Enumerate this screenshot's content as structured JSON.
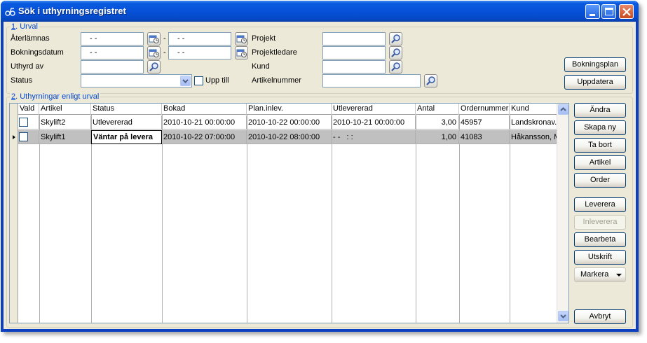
{
  "window": {
    "title": "Sök i uthyrningsregistret"
  },
  "filter_group": {
    "legend_num": "1",
    "legend_rest": ". Urval",
    "aterlamnas": {
      "label": "Återlämnas",
      "from": "- -",
      "sep": "-",
      "to": "- -"
    },
    "bokningsdatum": {
      "label": "Bokningsdatum",
      "from": "- -",
      "sep": "-",
      "to": "- -"
    },
    "uthyrd_av": {
      "label": "Uthyrd av",
      "value": ""
    },
    "status": {
      "label": "Status",
      "value": "",
      "upp_till_label": "Upp till"
    },
    "projekt": {
      "label": "Projekt",
      "value": ""
    },
    "projektledare": {
      "label": "Projektledare",
      "value": ""
    },
    "kund": {
      "label": "Kund",
      "value": ""
    },
    "artikelnummer": {
      "label": "Artikelnummer",
      "value": ""
    }
  },
  "top_buttons": {
    "bokningsplan": "Bokningsplan",
    "uppdatera": "Uppdatera"
  },
  "results_group": {
    "legend_num": "2",
    "legend_rest": ". Uthyrningar enligt urval",
    "columns": [
      "Vald",
      "Artikel",
      "Status",
      "Bokad",
      "Plan.inlev.",
      "Utlevererad",
      "Antal",
      "Ordernummer",
      "Kund"
    ],
    "rows": [
      {
        "vald": false,
        "artikel": "Skylift2",
        "status": "Utlevererad",
        "bokad": "2010-10-21 00:00:00",
        "plan_inlev": "2010-10-22 00:00:00",
        "utlevererad": "2010-10-21 00:00:00",
        "antal": "3,00",
        "ordernummer": "45957",
        "kund": "Landskronav..."
      },
      {
        "vald": false,
        "artikel": "Skylift1",
        "status": "Väntar på levera",
        "bokad": "2010-10-22 07:00:00",
        "plan_inlev": "2010-10-22 08:00:00",
        "utlevererad": "- -   : :",
        "antal": "1,00",
        "ordernummer": "41083",
        "kund": "Håkansson, M"
      }
    ]
  },
  "side_buttons": {
    "andra": "Ändra",
    "skapa_ny": "Skapa ny",
    "ta_bort": "Ta bort",
    "artikel": "Artikel",
    "order": "Order",
    "leverera": "Leverera",
    "inleverera": "Inleverera",
    "bearbeta": "Bearbeta",
    "utskrift": "Utskrift",
    "markera": "Markera",
    "avbryt": "Avbryt"
  },
  "colors": {
    "titlebar": "#0651d8",
    "client": "#ece9d8",
    "legend_text": "#0046d5",
    "selected_row": "#c0c0c0"
  }
}
